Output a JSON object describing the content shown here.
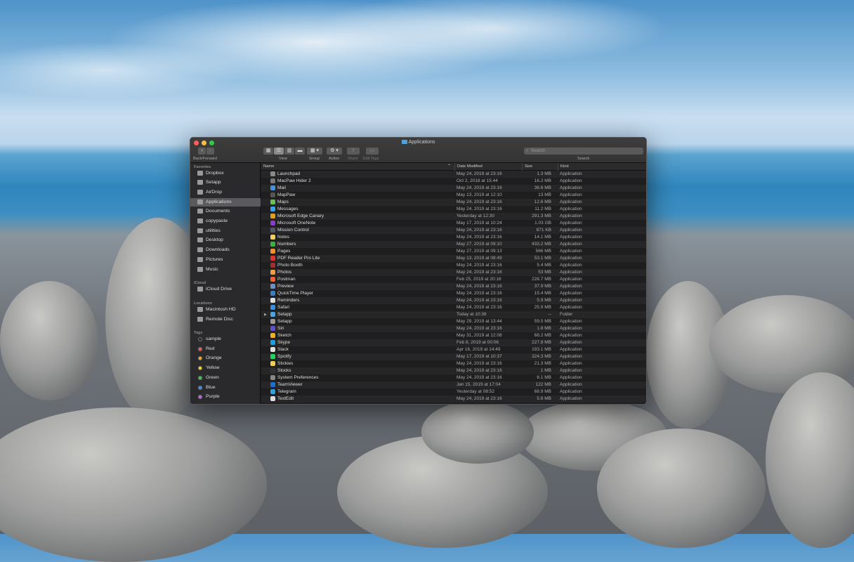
{
  "window": {
    "title": "Applications"
  },
  "toolbar": {
    "back_forward": "Back/Forward",
    "view": "View",
    "group": "Group",
    "action": "Action",
    "share": "Share",
    "edit_tags": "Edit Tags",
    "search_label": "Search",
    "search_placeholder": "Search"
  },
  "sidebar": {
    "favorites_header": "Favorites",
    "favorites": [
      "Dropbox",
      "Setapp",
      "AirDrop",
      "Applications",
      "Documents",
      "copypaste",
      "utilities",
      "Desktop",
      "Downloads",
      "Pictures",
      "Music"
    ],
    "icloud_header": "iCloud",
    "icloud": [
      "iCloud Drive"
    ],
    "locations_header": "Locations",
    "locations": [
      "Macintosh HD",
      "Remote Disc"
    ],
    "tags_header": "Tags",
    "tags": [
      {
        "label": "sample",
        "color": "#2a2a2c"
      },
      {
        "label": "Red",
        "color": "#f0524f"
      },
      {
        "label": "Orange",
        "color": "#f5a623"
      },
      {
        "label": "Yellow",
        "color": "#f8d81c"
      },
      {
        "label": "Green",
        "color": "#35c94a"
      },
      {
        "label": "Blue",
        "color": "#3a8df0"
      },
      {
        "label": "Purple",
        "color": "#c361e5"
      }
    ]
  },
  "columns": {
    "name": "Name",
    "date": "Date Modified",
    "size": "Size",
    "kind": "Kind"
  },
  "files": [
    [
      "Launchpad",
      "May 24, 2019 at 23:16",
      "1.3 MB",
      "Application",
      "#8a8a8a"
    ],
    [
      "MacPaw Hider 2",
      "Oct 2, 2018 at 15:44",
      "16.2 MB",
      "Application",
      "#777"
    ],
    [
      "Mail",
      "May 24, 2019 at 23:16",
      "36.6 MB",
      "Application",
      "#4a90d9"
    ],
    [
      "MapPaw",
      "May 13, 2019 at 12:10",
      "13 MB",
      "Application",
      "#555"
    ],
    [
      "Maps",
      "May 24, 2019 at 23:16",
      "12.6 MB",
      "Application",
      "#6cbf5a"
    ],
    [
      "Messages",
      "May 24, 2019 at 23:16",
      "11.2 MB",
      "Application",
      "#3aa0f0"
    ],
    [
      "Microsoft Edge Canary",
      "Yesterday at 12:30",
      "291.3 MB",
      "Application",
      "#e0a020"
    ],
    [
      "Microsoft OneNote",
      "May 17, 2019 at 10:24",
      "1.03 GB",
      "Application",
      "#8a3cc4"
    ],
    [
      "Mission Control",
      "May 24, 2019 at 23:16",
      "871 KB",
      "Application",
      "#556"
    ],
    [
      "Notes",
      "May 24, 2019 at 23:16",
      "14.1 MB",
      "Application",
      "#f0d060"
    ],
    [
      "Numbers",
      "May 27, 2019 at 09:10",
      "433.2 MB",
      "Application",
      "#3cb043"
    ],
    [
      "Pages",
      "May 27, 2019 at 09:13",
      "566 MB",
      "Application",
      "#f09030"
    ],
    [
      "PDF Reader Pro Lite",
      "May 13, 2019 at 08:49",
      "53.1 MB",
      "Application",
      "#e03030"
    ],
    [
      "Photo Booth",
      "May 24, 2019 at 23:16",
      "5.4 MB",
      "Application",
      "#a03030"
    ],
    [
      "Photos",
      "May 24, 2019 at 23:16",
      "53 MB",
      "Application",
      "#f0a040"
    ],
    [
      "Postman",
      "Feb 25, 2019 at 20:16",
      "228.7 MB",
      "Application",
      "#f06030"
    ],
    [
      "Preview",
      "May 24, 2019 at 23:16",
      "37.9 MB",
      "Application",
      "#7090c0"
    ],
    [
      "QuickTime Player",
      "May 24, 2019 at 23:16",
      "15.4 MB",
      "Application",
      "#3a80c0"
    ],
    [
      "Reminders",
      "May 24, 2019 at 23:16",
      "5.9 MB",
      "Application",
      "#ddd"
    ],
    [
      "Safari",
      "May 24, 2019 at 23:16",
      "25.9 MB",
      "Application",
      "#3a90e0"
    ],
    [
      "Setapp",
      "Today at 10:38",
      "--",
      "Folder",
      "#4ba3e0"
    ],
    [
      "Setapp",
      "May 29, 2019 at 13:44",
      "59.5 MB",
      "Application",
      "#999"
    ],
    [
      "Siri",
      "May 24, 2019 at 23:16",
      "1.8 MB",
      "Application",
      "#6050d0"
    ],
    [
      "Sketch",
      "May 31, 2019 at 12:08",
      "68.2 MB",
      "Application",
      "#f5b020"
    ],
    [
      "Skype",
      "Feb 8, 2019 at 00:06",
      "227.8 MB",
      "Application",
      "#20a0e0"
    ],
    [
      "Slack",
      "Apr 16, 2019 at 14:49",
      "193.1 MB",
      "Application",
      "#e0e0e0"
    ],
    [
      "Spotify",
      "May 17, 2019 at 10:37",
      "324.3 MB",
      "Application",
      "#1ed760"
    ],
    [
      "Stickies",
      "May 24, 2019 at 23:16",
      "21.3 MB",
      "Application",
      "#f0d050"
    ],
    [
      "Stocks",
      "May 24, 2019 at 23:16",
      "1 MB",
      "Application",
      "#333"
    ],
    [
      "System Preferences",
      "May 24, 2019 at 23:16",
      "6.1 MB",
      "Application",
      "#888"
    ],
    [
      "TeamViewer",
      "Jan 15, 2019 at 17:04",
      "122 MB",
      "Application",
      "#1a70d0"
    ],
    [
      "Telegram",
      "Yesterday at 08:52",
      "68.9 MB",
      "Application",
      "#30a0e0"
    ],
    [
      "TextEdit",
      "May 24, 2019 at 23:16",
      "5.6 MB",
      "Application",
      "#ddd"
    ]
  ]
}
